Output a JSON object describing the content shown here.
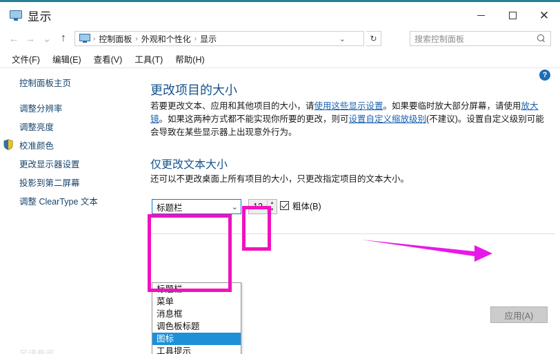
{
  "window": {
    "title": "显示",
    "icon": "monitor-icon",
    "controls": {
      "minimize": "—",
      "maximize": "□",
      "close": "✕"
    }
  },
  "nav": {
    "back_icon": "←",
    "forward_icon": "→",
    "history_icon": "⌄",
    "up_icon": "↑",
    "breadcrumbs": [
      "控制面板",
      "外观和个性化",
      "显示"
    ],
    "breadcrumb_separator": "›",
    "address_dropdown_icon": "⌄",
    "refresh_icon": "↻"
  },
  "search": {
    "placeholder": "搜索控制面板",
    "icon": "search-icon"
  },
  "menubar": {
    "items": [
      "文件(F)",
      "编辑(E)",
      "查看(V)",
      "工具(T)",
      "帮助(H)"
    ]
  },
  "sidebar": {
    "home": "控制面板主页",
    "items": [
      {
        "label": "调整分辨率",
        "shield": false
      },
      {
        "label": "调整亮度",
        "shield": false
      },
      {
        "label": "校准颜色",
        "shield": true
      },
      {
        "label": "更改显示器设置",
        "shield": false
      },
      {
        "label": "投影到第二屏幕",
        "shield": false
      },
      {
        "label": "调整 ClearType 文本",
        "shield": false
      }
    ],
    "bottom_faint": "另请参阅"
  },
  "main": {
    "help_icon": "?",
    "heading1": "更改项目的大小",
    "paragraph1": {
      "part1": "若要更改文本、应用和其他项目的大小，请",
      "link1": "使用这些显示设置",
      "part2": "。如果要临时放大部分屏幕，请使用",
      "link2": "放大镜",
      "part3": "。如果这两种方式都不能实现你所要的更改，则可",
      "link3": "设置自定义缩放级别",
      "part4": "(不建议)。设置自定义级别可能会导致在某些显示器上出现意外行为。"
    },
    "heading2": "仅更改文本大小",
    "paragraph2": "还可以不更改桌面上所有项目的大小，只更改指定项目的文本大小。",
    "combo": {
      "value": "标题栏",
      "chevron": "⌄",
      "options": [
        "标题栏",
        "菜单",
        "消息框",
        "调色板标题",
        "图标",
        "工具提示"
      ],
      "highlighted_option": "图标"
    },
    "size_spinner": {
      "value": "12",
      "up_icon": "▲",
      "down_icon": "▼"
    },
    "bold_checkbox": {
      "label": "粗体(B)",
      "checked": true
    },
    "apply_button": {
      "label": "应用(A)",
      "disabled": true
    }
  },
  "annotations": {
    "highlight_color": "#f012be",
    "arrow_color": "#e818e8",
    "spinner_highlight": "size-spinner",
    "dropdown_highlight": "combo-dropdown-list",
    "arrow_points_to": "apply-button"
  }
}
